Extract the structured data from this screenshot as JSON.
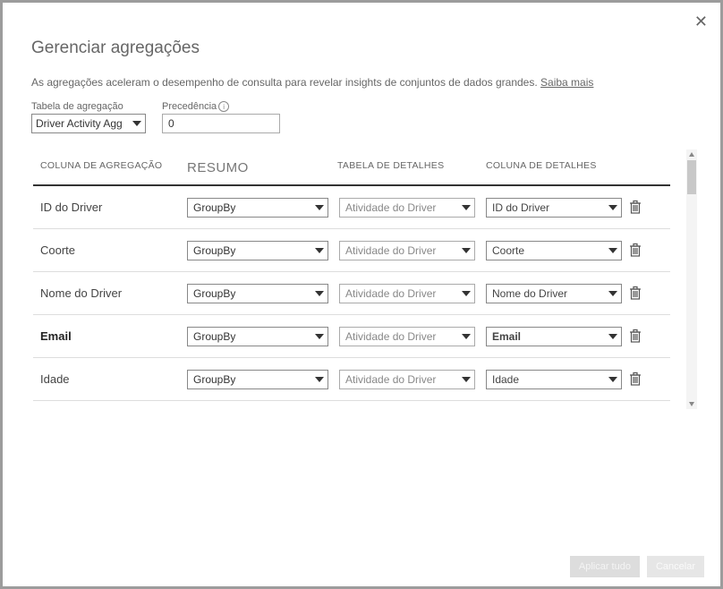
{
  "dialog": {
    "title": "Gerenciar agregações",
    "subtitle": "As agregações aceleram o desempenho de consulta para revelar insights de conjuntos de dados grandes. ",
    "learn_more": "Saiba mais"
  },
  "controls": {
    "agg_table_label": "Tabela de agregação",
    "agg_table_value": "Driver Activity Agg",
    "precedence_label": "Precedência",
    "precedence_value": "0"
  },
  "columns": {
    "agg": "COLUNA DE AGREGAÇÃO",
    "resumo": "RESUMO",
    "detail_table": "TABELA DE DETALHES",
    "detail_col": "COLUNA DE DETALHES"
  },
  "rows": [
    {
      "agg": "ID do Driver",
      "agg_bold": false,
      "resumo": "GroupBy",
      "detail_table": "Atividade do Driver",
      "detail_col": "ID do Driver",
      "detcol_bold": false
    },
    {
      "agg": "Coorte",
      "agg_bold": false,
      "resumo": "GroupBy",
      "detail_table": "Atividade do Driver",
      "detail_col": "Coorte",
      "detcol_bold": false
    },
    {
      "agg": "Nome do Driver",
      "agg_bold": false,
      "resumo": "GroupBy",
      "detail_table": "Atividade do Driver",
      "detail_col": "Nome do Driver",
      "detcol_bold": false
    },
    {
      "agg": "Email",
      "agg_bold": true,
      "resumo": "GroupBy",
      "detail_table": "Atividade do Driver",
      "detail_col": "Email",
      "detcol_bold": true
    },
    {
      "agg": "Idade",
      "agg_bold": false,
      "resumo": "GroupBy",
      "detail_table": "Atividade do Driver",
      "detail_col": "Idade",
      "detcol_bold": false
    }
  ],
  "footer": {
    "apply": "Aplicar tudo",
    "cancel": "Cancelar"
  }
}
